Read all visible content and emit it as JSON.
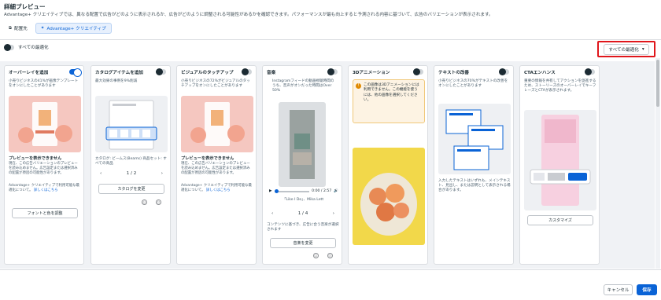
{
  "header": {
    "title": "詳細プレビュー",
    "subtitle": "Advantage+ クリエイティブでは、異なる配置で広告がどのように表示されるか、広告がどのように調整される可能性があるかを確認できます。パフォーマンスが最も向上すると予測される内容に基づいて、広告のバリエーションが表示されます。"
  },
  "tabs": [
    {
      "label": "配置先",
      "icon": "placement-icon"
    },
    {
      "label": "Advantage+ クリエイティブ",
      "icon": "sparkle-icon"
    }
  ],
  "global_toggle": {
    "label": "すべての最適化",
    "state": "off"
  },
  "optimize_button": {
    "label": "すべての最適化"
  },
  "cards": [
    {
      "title": "オーバーレイを追加",
      "toggle": "on",
      "note": "小売りビジネスの41%が画像テンプレートをオンにしたことがあります",
      "preview_title": "プレビューを表示できません",
      "preview_desc": "現在、この広告バリエーションのプレビューを読み込めません。広告設定または選択済みの配置が原因の可能性があります。",
      "footer_desc": "Advantage+ クリエイティブで利用可能な最適化について。",
      "link": "詳しくはこちら",
      "button": "フォントと色を調整"
    },
    {
      "title": "カタログアイテムを追加",
      "toggle": "off",
      "note": "最大効果の事例を9%削減",
      "caption": "カタログ: ビームス(Beams) 商品セット: すべての商品",
      "pager": "1 / 2",
      "button": "カタログを変更"
    },
    {
      "title": "ビジュアルのタッチアップ",
      "toggle": "off",
      "note": "小売りビジネスの72%がビジュアルのタッチアップをオンにしたことがあります",
      "preview_title": "プレビューを表示できません",
      "preview_desc": "現在、この広告バリエーションのプレビューを読み込めません。広告設定または選択済みの配置が原因の可能性があります。",
      "footer_desc": "Advantage+ クリエイティブで利用可能な最適化について。",
      "link": "詳しくはこちら"
    },
    {
      "title": "音楽",
      "toggle": "off",
      "note": "Instagramフィードの動画視聴時間のうち、音声がオンだった時間はOver 50%",
      "time": "0:00 / 2:57",
      "song": "「Like I Do」、Mika Lett",
      "pager": "1 / 4",
      "caption": "コンテンツに基づき、広告に合う音楽が選択されます",
      "button": "音楽を変更"
    },
    {
      "title": "3Dアニメーション",
      "toggle": "off",
      "warning": "この画像は3Dアニメーションには利用できません。この機能を使うには、他の画像を選択してください。"
    },
    {
      "title": "テキストの改善",
      "toggle": "off",
      "note": "小売りビジネスの70%がテキストの改善をオンにしたことがあります",
      "caption": "入力したテキストはいずれも、メインテキスト、見出し、または説明として表示される場合があります。"
    },
    {
      "title": "CTAエンハンス",
      "toggle": "off",
      "note": "重要の情報を共有してアクションを促進するため、ストーリーズのオーバーレイでキーフレーズとCTAが表示されます。",
      "button": "カスタマイズ"
    }
  ],
  "footer": {
    "cancel": "キャンセル",
    "save": "保存"
  },
  "colors": {
    "accent": "#0a63d6",
    "highlight": "#e0161b"
  }
}
